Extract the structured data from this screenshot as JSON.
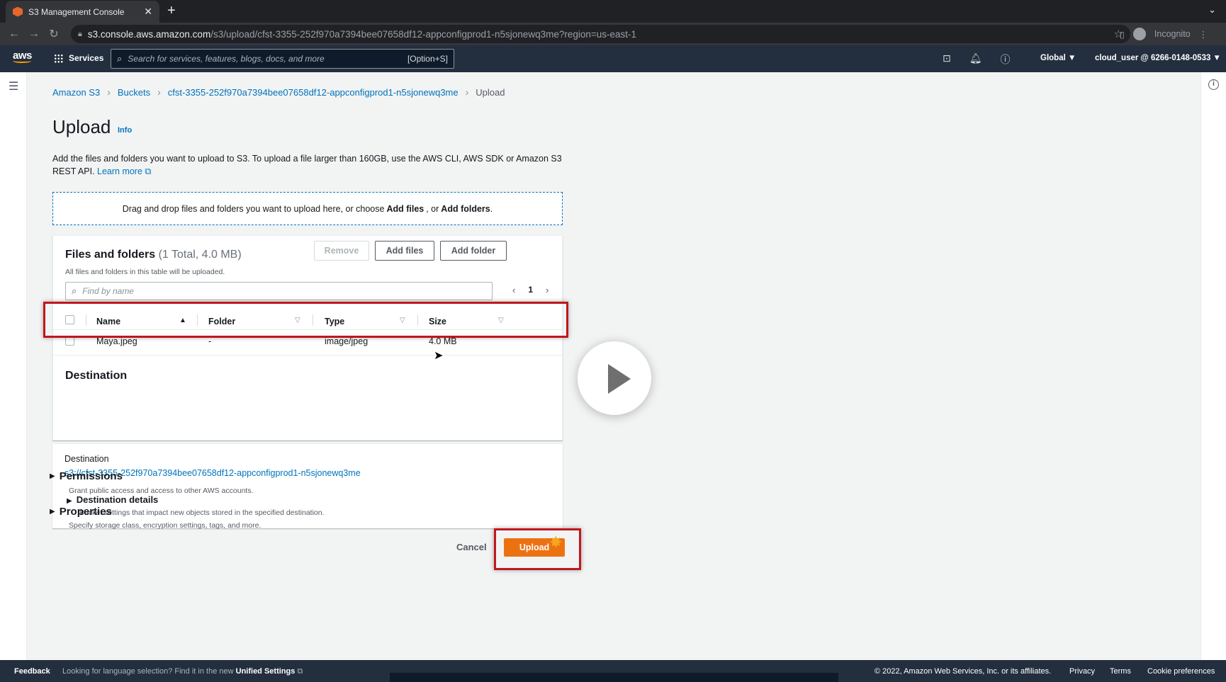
{
  "browser": {
    "tab_title": "S3 Management Console",
    "tab_close": "✕",
    "new_tab": "+",
    "url_host": "s3.console.aws.amazon.com",
    "url_path": "/s3/upload/cfst-3355-252f970a7394bee07658df12-appconfigprod1-n5sjonewq3me?region=us-east-1",
    "incognito_label": "Incognito"
  },
  "awsnav": {
    "logo": "aws",
    "services_label": "Services",
    "search_placeholder": "Search for services, features, blogs, docs, and more",
    "search_shortcut": "[Option+S]",
    "region": "Global ▼",
    "account": "cloud_user @ 6266-0148-0533 ▼"
  },
  "breadcrumb": {
    "items": [
      "Amazon S3",
      "Buckets",
      "cfst-3355-252f970a7394bee07658df12-appconfigprod1-n5sjonewq3me"
    ],
    "current": "Upload"
  },
  "page": {
    "title": "Upload",
    "info": "Info",
    "description": "Add the files and folders you want to upload to S3. To upload a file larger than 160GB, use the AWS CLI, AWS SDK or Amazon S3 REST API.",
    "learn_more": "Learn more",
    "dropzone_pre": "Drag and drop files and folders you want to upload here, or choose",
    "dropzone_add_files": "Add files",
    "dropzone_or": ", or",
    "dropzone_add_folders": "Add folders",
    "dropzone_end": "."
  },
  "files": {
    "heading": "Files and folders",
    "count": "(1 Total, 4.0 MB)",
    "subtitle": "All files and folders in this table will be uploaded.",
    "remove_label": "Remove",
    "add_files_label": "Add files",
    "add_folder_label": "Add folder",
    "find_placeholder": "Find by name",
    "page_number": "1",
    "columns": [
      "Name",
      "Folder",
      "Type",
      "Size"
    ],
    "rows": [
      {
        "name": "Maya.jpeg",
        "folder": "-",
        "type": "image/jpeg",
        "size": "4.0 MB"
      }
    ]
  },
  "destination": {
    "heading": "Destination",
    "label": "Destination",
    "link": "s3://cfst-3355-252f970a7394bee07658df12-appconfigprod1-n5sjonewq3me",
    "details_title": "Destination details",
    "details_sub": "Bucket settings that impact new objects stored in the specified destination."
  },
  "permissions": {
    "title": "Permissions",
    "sub": "Grant public access and access to other AWS accounts."
  },
  "properties": {
    "title": "Properties",
    "sub": "Specify storage class, encryption settings, tags, and more."
  },
  "actions": {
    "cancel_label": "Cancel",
    "upload_label": "Upload"
  },
  "footer": {
    "feedback": "Feedback",
    "lang_text": "Looking for language selection? Find it in the new",
    "unified_settings": "Unified Settings",
    "copyright": "© 2022, Amazon Web Services, Inc. or its affiliates.",
    "privacy": "Privacy",
    "terms": "Terms",
    "cookies": "Cookie preferences"
  },
  "colors": {
    "aws_nav": "#232f3e",
    "link": "#0073bb",
    "primary_button": "#ec7211",
    "highlight_box": "#c0171c"
  }
}
